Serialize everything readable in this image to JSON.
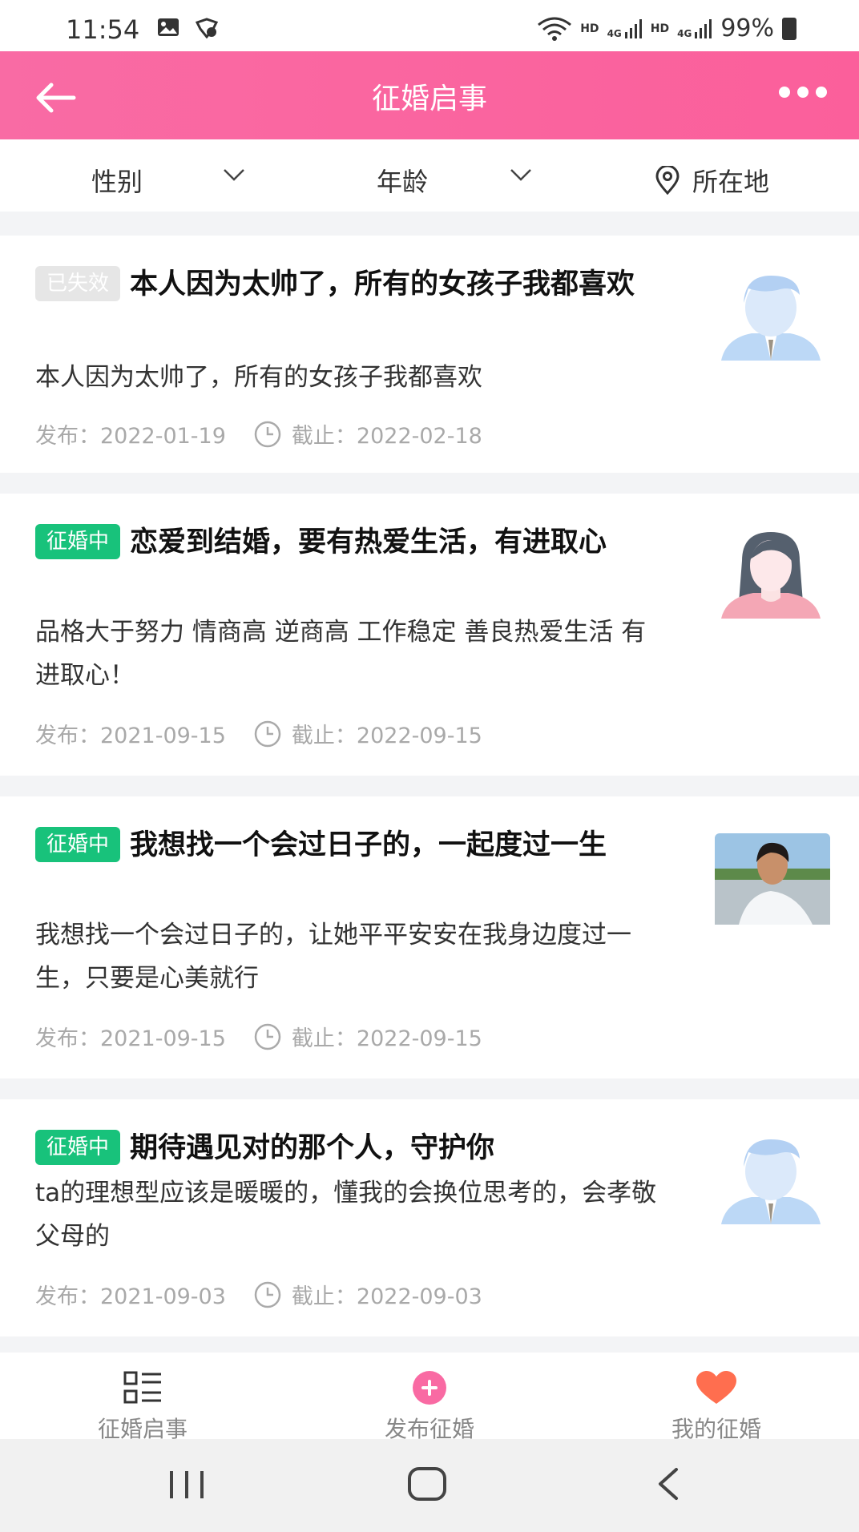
{
  "status": {
    "time": "11:54",
    "hd1": "HD",
    "net1": "4G",
    "hd2": "HD",
    "net2": "4G",
    "battery": "99%"
  },
  "header": {
    "title": "征婚启事"
  },
  "filters": {
    "gender": "性别",
    "age": "年龄",
    "location": "所在地"
  },
  "listings": [
    {
      "badge": "已失效",
      "title": "本人因为太帅了，所有的女孩子我都喜欢",
      "desc": "本人因为太帅了，所有的女孩子我都喜欢",
      "published": "发布：2022-01-19",
      "deadline": "截止：2022-02-18",
      "avatar": "male-avatar-icon"
    },
    {
      "badge": "征婚中",
      "title": "恋爱到结婚，要有热爱生活，有进取心",
      "desc": "品格大于努力 情商高 逆商高 工作稳定 善良热爱生活 有进取心！",
      "published": "发布：2021-09-15",
      "deadline": "截止：2022-09-15",
      "avatar": "female-avatar-icon"
    },
    {
      "badge": "征婚中",
      "title": "我想找一个会过日子的，一起度过一生",
      "desc": "我想找一个会过日子的，让她平平安安在我身边度过一生，只要是心美就行",
      "published": "发布：2021-09-15",
      "deadline": "截止：2022-09-15",
      "avatar": "user-photo"
    },
    {
      "badge": "征婚中",
      "title": "期待遇见对的那个人，守护你",
      "desc": "ta的理想型应该是暖暖的，懂我的会换位思考的，会孝敬父母的",
      "published": "发布：2021-09-03",
      "deadline": "截止：2022-09-03",
      "avatar": "male-avatar-icon"
    }
  ],
  "tabbar": {
    "listings": "征婚启事",
    "publish": "发布征婚",
    "mine": "我的征婚"
  },
  "colors": {
    "brand": "#fb6aa3",
    "active_badge": "#18c27b",
    "expired_badge": "#e6e6e6",
    "heart": "#ff6e4f"
  }
}
